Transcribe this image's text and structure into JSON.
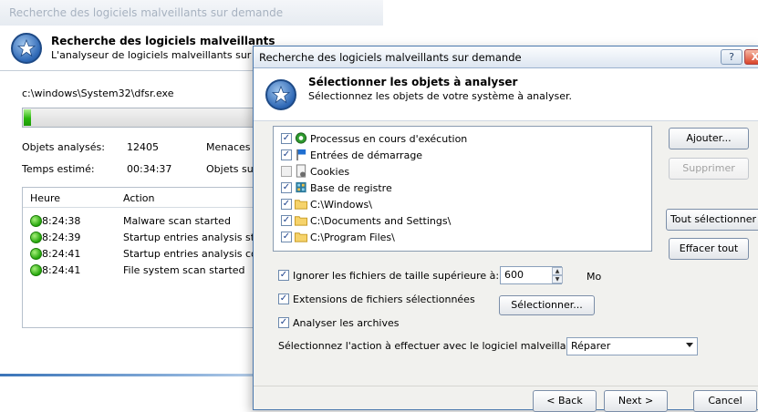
{
  "background_window": {
    "title": "Recherche des logiciels malveillants sur demande",
    "header_title": "Recherche des logiciels malveillants",
    "header_subtitle": "L'analyseur de logiciels malveillants sur de",
    "current_file": "c:\\windows\\System32\\dfsr.exe",
    "progress_fraction": 0.02,
    "stats": {
      "scanned_label": "Objets analysés:",
      "scanned_value": "12405",
      "threats_label": "Menaces",
      "time_label": "Temps estimé:",
      "time_value": "00:34:37",
      "objects_label": "Objets su"
    },
    "log": {
      "col_time": "Heure",
      "col_action": "Action",
      "rows": [
        {
          "time": "8:24:38",
          "action": "Malware scan started"
        },
        {
          "time": "8:24:39",
          "action": "Startup entries analysis st"
        },
        {
          "time": "8:24:41",
          "action": "Startup entries analysis co"
        },
        {
          "time": "8:24:41",
          "action": "File system scan started"
        }
      ]
    }
  },
  "dialog": {
    "title": "Recherche des logiciels malveillants sur demande",
    "help_label": "?",
    "close_label": "X",
    "header_title": "Sélectionner les objets à analyser",
    "header_subtitle": "Sélectionnez les objets de votre système à analyser.",
    "objects": [
      {
        "label": "Processus en cours d'exécution",
        "checked": true,
        "icon": "gear-icon"
      },
      {
        "label": "Entrées de démarrage",
        "checked": true,
        "icon": "flag-icon"
      },
      {
        "label": "Cookies",
        "checked": false,
        "icon": "cookie-icon"
      },
      {
        "label": "Base de registre",
        "checked": true,
        "icon": "registry-icon"
      },
      {
        "label": "C:\\Windows\\",
        "checked": true,
        "icon": "folder-icon"
      },
      {
        "label": "C:\\Documents and Settings\\",
        "checked": true,
        "icon": "folder-icon"
      },
      {
        "label": "C:\\Program Files\\",
        "checked": true,
        "icon": "folder-icon"
      }
    ],
    "buttons": {
      "add": "Ajouter...",
      "remove": "Supprimer",
      "select_all": "Tout sélectionner",
      "clear_all": "Effacer tout",
      "select_ext": "Sélectionner...",
      "back": "< Back",
      "next": "Next >",
      "cancel": "Cancel"
    },
    "options": {
      "ignore_size_label": "Ignorer les fichiers de taille supérieure à:",
      "ignore_size_value": "600",
      "ignore_size_unit": "Mo",
      "ignore_size_checked": true,
      "extensions_label": "Extensions de fichiers sélectionnées",
      "extensions_checked": true,
      "archives_label": "Analyser les archives",
      "archives_checked": true,
      "action_label": "Sélectionnez l'action à effectuer avec le logiciel malveillant",
      "action_value": "Réparer"
    }
  },
  "colors": {
    "progress_green": "#29b60d",
    "titlebar_blue": "#dde6f1",
    "dialog_body": "#f1f1ee"
  }
}
